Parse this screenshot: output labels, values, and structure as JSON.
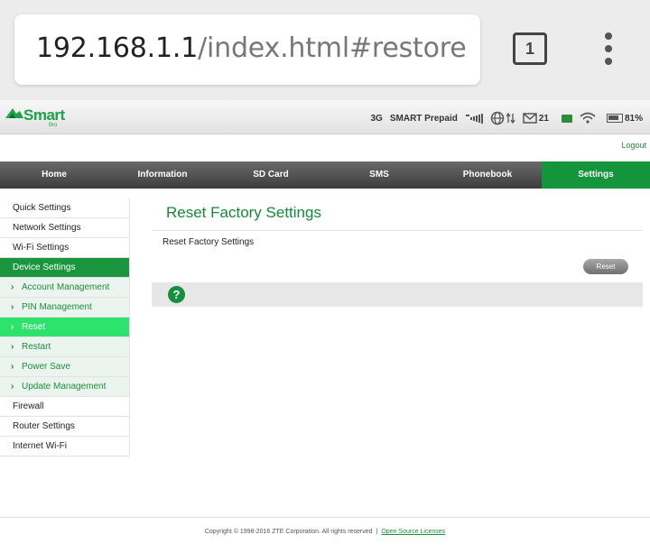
{
  "browser": {
    "url_host": "192.168.1.1",
    "url_path": "/index.html#restore",
    "tab_count": "1",
    "menu_icon": "more-vert-icon"
  },
  "header": {
    "logo_text": "Smart",
    "logo_sub": "Bro",
    "network_type": "3G",
    "carrier": "SMART Prepaid",
    "sms_count": "21",
    "battery": "81%",
    "brand_color": "#14953b"
  },
  "logout_label": "Logout",
  "nav": [
    {
      "label": "Home"
    },
    {
      "label": "Information"
    },
    {
      "label": "SD Card"
    },
    {
      "label": "SMS"
    },
    {
      "label": "Phonebook"
    },
    {
      "label": "Settings"
    }
  ],
  "sidebar": {
    "items": [
      {
        "label": "Quick Settings"
      },
      {
        "label": "Network Settings"
      },
      {
        "label": "Wi-Fi Settings"
      },
      {
        "label": "Device Settings"
      },
      {
        "label": "Account Management"
      },
      {
        "label": "PIN Management"
      },
      {
        "label": "Reset"
      },
      {
        "label": "Restart"
      },
      {
        "label": "Power Save"
      },
      {
        "label": "Update Management"
      },
      {
        "label": "Firewall"
      },
      {
        "label": "Router Settings"
      },
      {
        "label": "Internet Wi-Fi"
      }
    ]
  },
  "main": {
    "title": "Reset Factory Settings",
    "section_label": "Reset Factory Settings",
    "reset_button": "Reset",
    "help_icon_text": "?"
  },
  "footer": {
    "copyright": "Copyright © 1998-2016 ZTE Corporation. All rights reserved",
    "separator": "|",
    "link": "Open Source Licenses"
  }
}
